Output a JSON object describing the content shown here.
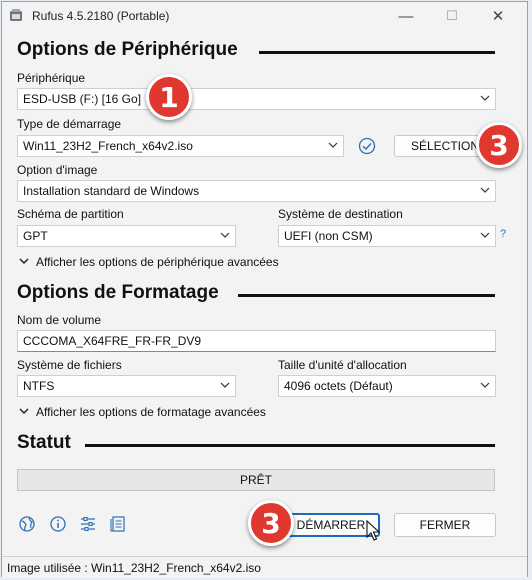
{
  "window": {
    "title": "Rufus 4.5.2180 (Portable)",
    "minimize_glyph": "—",
    "maximize_glyph": "☐",
    "close_glyph": "✕"
  },
  "device_section": {
    "heading": "Options de Périphérique",
    "device_label": "Périphérique",
    "device_value": "ESD-USB (F:) [16 Go]",
    "boot_type_label": "Type de démarrage",
    "boot_type_value": "Win11_23H2_French_x64v2.iso",
    "select_button": "SÉLECTION",
    "image_option_label": "Option d'image",
    "image_option_value": "Installation standard de Windows",
    "partition_label": "Schéma de partition",
    "partition_value": "GPT",
    "target_label": "Système de destination",
    "target_value": "UEFI (non CSM)",
    "help_glyph": "?",
    "advanced_toggle": "Afficher les options de périphérique avancées"
  },
  "format_section": {
    "heading": "Options de Formatage",
    "volume_label": "Nom de volume",
    "volume_value": "CCCOMA_X64FRE_FR-FR_DV9",
    "fs_label": "Système de fichiers",
    "fs_value": "NTFS",
    "cluster_label": "Taille d'unité d'allocation",
    "cluster_value": "4096 octets (Défaut)",
    "advanced_toggle": "Afficher les options de formatage avancées"
  },
  "status_section": {
    "heading": "Statut",
    "progress_text": "PRÊT",
    "progress_fraction": 0
  },
  "footer": {
    "start_button": "DÉMARRER",
    "close_button": "FERMER",
    "status_bar": "Image utilisée : Win11_23H2_French_x64v2.iso"
  },
  "annotations": {
    "badge_device": "1",
    "badge_select": "3",
    "badge_start": "3",
    "badge_color": "#e0382f"
  },
  "icons": [
    "rufus-app-icon",
    "globe-icon",
    "info-icon",
    "settings-sliders-icon",
    "log-icon",
    "check-circle-icon",
    "chevron-down-icon"
  ],
  "colors": {
    "accent": "#1c6ab8",
    "check": "#2f6fb3"
  }
}
